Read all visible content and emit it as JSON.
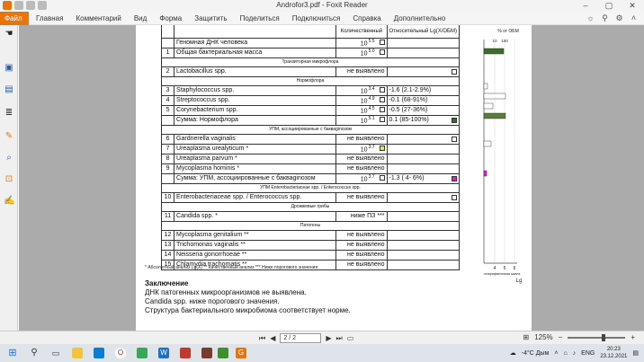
{
  "window": {
    "title": "Androfor3.pdf - Foxit Reader"
  },
  "menu": {
    "file": "Файл",
    "items": [
      "Главная",
      "Комментарий",
      "Вид",
      "Форма",
      "Защитить",
      "Поделиться",
      "Подключиться",
      "Справка",
      "Дополнительно"
    ]
  },
  "table_header": {
    "qty": "Количественный",
    "rel": "Относительный Lg(X/ОБМ)"
  },
  "rows": [
    {
      "type": "row",
      "num": "",
      "name": "Геномная ДНК человека",
      "qty": "10",
      "exp": "5.5",
      "box": "empty",
      "rel": "",
      "relbox": ""
    },
    {
      "type": "row",
      "num": "1",
      "name": "Общая бактериальная масса",
      "qty": "10",
      "exp": "5.0",
      "box": "empty",
      "rel": "",
      "relbox": ""
    },
    {
      "type": "section",
      "label": "Транзиторная микрофлора"
    },
    {
      "type": "row",
      "num": "2",
      "name": "Lactobacillus spp.",
      "qty": "не выявлено",
      "exp": "",
      "box": "",
      "rel": "",
      "relbox": "empty"
    },
    {
      "type": "section",
      "label": "Нормофлора"
    },
    {
      "type": "row",
      "num": "3",
      "name": "Staphylococcus spp.",
      "qty": "10",
      "exp": "3.4",
      "box": "empty",
      "rel": "-1.6 (2.1-2.9%)",
      "relbox": ""
    },
    {
      "type": "row",
      "num": "4",
      "name": "Streptococcus spp.",
      "qty": "10",
      "exp": "4.9",
      "box": "empty",
      "rel": "-0.1 (68-91%)",
      "relbox": ""
    },
    {
      "type": "row",
      "num": "5",
      "name": "Corynebacterium spp.",
      "qty": "10",
      "exp": "4.5",
      "box": "empty",
      "rel": "-0.5 (27-36%)",
      "relbox": ""
    },
    {
      "type": "row",
      "num": "",
      "name": "Сумма: Нормофлора",
      "qty": "10",
      "exp": "5.1",
      "box": "empty",
      "rel": "0.1 (85-100%)",
      "relbox": "green"
    },
    {
      "type": "section",
      "label": "УПМ, ассоциированные с бакваginозом"
    },
    {
      "type": "row",
      "num": "6",
      "name": "Gardnerella vaginalis",
      "qty": "не выявлено",
      "exp": "",
      "box": "",
      "rel": "",
      "relbox": "empty"
    },
    {
      "type": "row",
      "num": "7",
      "name": "Ureaplasma urealyticum *",
      "qty": "10",
      "exp": "3.7",
      "box": "yellow",
      "rel": "",
      "relbox": ""
    },
    {
      "type": "row",
      "num": "8",
      "name": "Ureaplasma parvum *",
      "qty": "не выявлено",
      "exp": "",
      "box": "",
      "rel": "",
      "relbox": ""
    },
    {
      "type": "row",
      "num": "9",
      "name": "Mycoplasma hominis *",
      "qty": "не выявлено",
      "exp": "",
      "box": "",
      "rel": "",
      "relbox": ""
    },
    {
      "type": "row",
      "num": "",
      "name": "Сумма: УПМ, ассоциированные с бакваginозом",
      "qty": "10",
      "exp": "3.7",
      "box": "empty",
      "rel": "-1.3 ( 4- 6%)",
      "relbox": "magenta"
    },
    {
      "type": "section",
      "label": "УПМ Enterobacteriaceae spp. / Enterococcus spp."
    },
    {
      "type": "row",
      "num": "10",
      "name": "Enterobacteriaceae spp. / Enterococcus spp.",
      "qty": "не выявлено",
      "exp": "",
      "box": "",
      "rel": "",
      "relbox": "empty"
    },
    {
      "type": "section",
      "label": "Дрожжевые грибы"
    },
    {
      "type": "row",
      "num": "11",
      "name": "Candida spp. *",
      "qty": "ниже ПЗ ***",
      "exp": "",
      "box": "",
      "rel": "",
      "relbox": ""
    },
    {
      "type": "section",
      "label": "Патогены"
    },
    {
      "type": "row",
      "num": "12",
      "name": "Mycoplasma genitalium **",
      "qty": "не выявлено",
      "exp": "",
      "box": "",
      "rel": "",
      "relbox": ""
    },
    {
      "type": "row",
      "num": "13",
      "name": "Trichomonas vaginalis **",
      "qty": "не выявлено",
      "exp": "",
      "box": "",
      "rel": "",
      "relbox": ""
    },
    {
      "type": "row",
      "num": "14",
      "name": "Neisseria gonorrhoeae **",
      "qty": "не выявлено",
      "exp": "",
      "box": "",
      "rel": "",
      "relbox": ""
    },
    {
      "type": "row",
      "num": "15",
      "name": "Chlamydia trachomatis **",
      "qty": "не выявлено",
      "exp": "",
      "box": "",
      "rel": "",
      "relbox": ""
    }
  ],
  "chart": {
    "top_ticks": [
      "10",
      "100"
    ],
    "top_label": "% от ОБМ",
    "bottom_ticks": [
      "4",
      "5",
      "6"
    ],
    "bottom_label": "логарифмическая шкала",
    "axis_label": "Lg"
  },
  "footnote": "*  Абсолютный анализ Lg(X)   ** Качественный анализ   *** Ниже порогового значения",
  "conclusion": {
    "heading": "Заключение",
    "lines": [
      "ДНК патогенных микроорганизмов не выявлена.",
      "Candida spp. ниже порогового значения.",
      "Структура бактериального микробиома соответствует норме."
    ]
  },
  "nav": {
    "page": "2 / 2",
    "zoom": "125%"
  },
  "taskbar": {
    "weather": "-4°C Дым",
    "lang": "ENG",
    "time": "20:23",
    "date": "23.12.2021"
  },
  "colors": {
    "accent": "#e8740c",
    "green": "#3e6c2e",
    "magenta": "#e021c8",
    "yellow": "#ece067"
  }
}
